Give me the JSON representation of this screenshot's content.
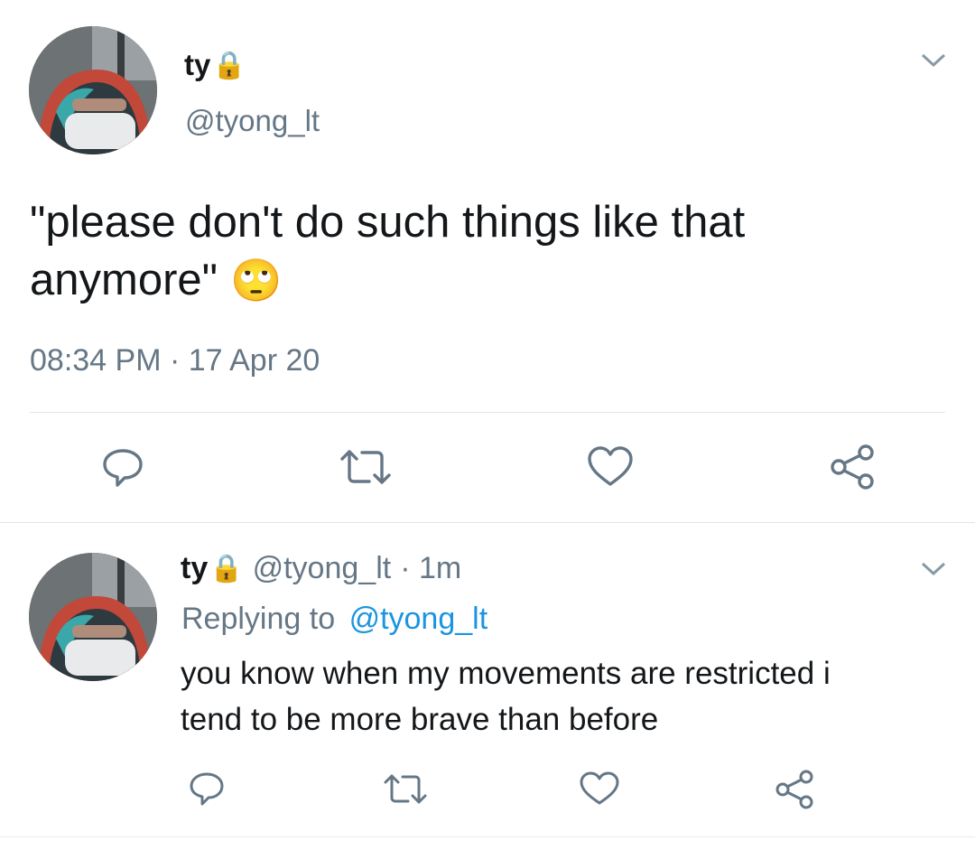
{
  "main_tweet": {
    "display_name": "ty",
    "lock_emoji": "🔒",
    "handle": "@tyong_lt",
    "text_line1": "\"please don't do such things like that",
    "text_line2": "anymore\"",
    "emoji": "🙄",
    "timestamp": "08:34 PM · 17 Apr 20"
  },
  "reply_tweet": {
    "display_name": "ty",
    "lock_emoji": "🔒",
    "handle": "@tyong_lt",
    "time": "· 1m",
    "replying_prefix": "Replying to",
    "replying_handle": "@tyong_lt",
    "text_line1": "you know when my movements are restricted i",
    "text_line2": "tend to be more brave than before"
  },
  "icons": {
    "reply": "reply-icon",
    "retweet": "retweet-icon",
    "like": "heart-icon",
    "share": "share-icon",
    "more": "chevron-down-icon"
  },
  "colors": {
    "text": "#14171a",
    "secondary": "#657786",
    "link": "#1b95e0",
    "divider": "#e1e8ed"
  }
}
